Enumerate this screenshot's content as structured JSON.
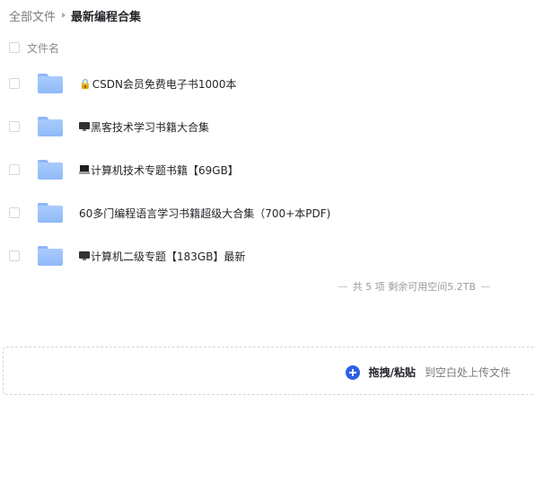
{
  "breadcrumb": {
    "root": "全部文件",
    "current": "最新编程合集"
  },
  "list_header": {
    "name_column": "文件名"
  },
  "files": [
    {
      "prefix_icon": "lock-icon",
      "name": "CSDN会员免费电子书1000本"
    },
    {
      "prefix_icon": "monitor-icon",
      "name": "黑客技术学习书籍大合集"
    },
    {
      "prefix_icon": "laptop-icon",
      "name": "计算机技术专题书籍【69GB】"
    },
    {
      "prefix_icon": "",
      "name": "60多门编程语言学习书籍超级大合集（700+本PDF)"
    },
    {
      "prefix_icon": "monitor-icon",
      "name": "计算机二级专题【183GB】最新"
    }
  ],
  "summary": "共 5 项 剩余可用空间5.2TB",
  "upload": {
    "label": "拖拽/粘贴",
    "hint": "到空白处上传文件"
  },
  "colors": {
    "accent": "#2b5fe6",
    "folder": "#9cc2fa"
  }
}
